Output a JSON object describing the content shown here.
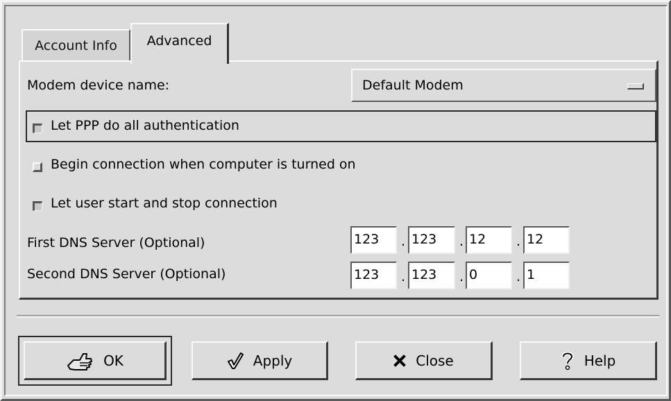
{
  "tabs": [
    {
      "label": "Account Info",
      "active": false
    },
    {
      "label": "Advanced",
      "active": true
    }
  ],
  "modem": {
    "label": "Modem device name:",
    "value": "Default Modem"
  },
  "checkboxes": {
    "ppp_auth": {
      "label": "Let PPP do all authentication",
      "checked": true
    },
    "begin_on_boot": {
      "label": "Begin connection when computer is turned on",
      "checked": false
    },
    "user_control": {
      "label": "Let user start and stop connection",
      "checked": true
    }
  },
  "dns": {
    "first": {
      "label": "First DNS Server (Optional)",
      "octets": [
        "123",
        "123",
        "12",
        "12"
      ]
    },
    "second": {
      "label": "Second DNS Server (Optional)",
      "octets": [
        "123",
        "123",
        "0",
        "1"
      ]
    },
    "separator": "."
  },
  "buttons": {
    "ok": {
      "label": "OK",
      "icon": "hand-pointer-icon"
    },
    "apply": {
      "label": "Apply",
      "icon": "checkmark-icon"
    },
    "close": {
      "label": "Close",
      "icon": "x-close-icon"
    },
    "help": {
      "label": "Help",
      "icon": "question-mark-icon"
    }
  }
}
